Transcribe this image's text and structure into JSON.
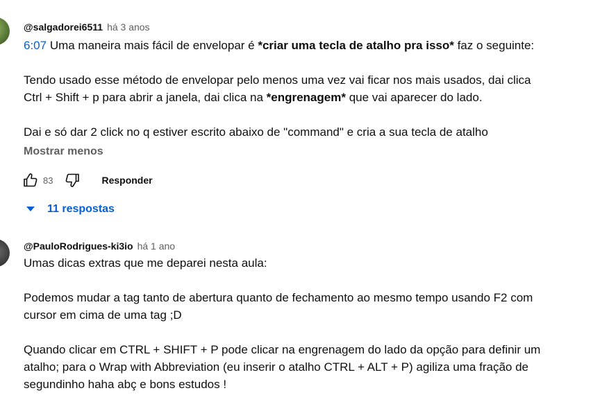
{
  "comments": [
    {
      "author": "@salgadorei6511",
      "time": "há 3 anos",
      "timestamp": "6:07",
      "line1_a": " Uma maneira mais fácil de envelopar é ",
      "line1_bold": "*criar uma tecla de atalho pra isso*",
      "line1_b": " faz o seguinte:",
      "para2_line1": "Tendo usado esse método de envelopar pelo menos uma vez vai ficar nos mais usados, dai clica",
      "para2_line2_a": "Ctrl + Shift + p para abrir a janela, dai clica na ",
      "para2_line2_bold": "*engrenagem*",
      "para2_line2_b": " que vai aparecer do lado.",
      "para3": "Dai e só dar 2 click no q estiver escrito abaixo de \"command\" e cria a sua tecla de atalho",
      "show_less": "Mostrar menos",
      "likes": "83",
      "reply_label": "Responder",
      "replies_label": "11 respostas"
    },
    {
      "author": "@PauloRodrigues-ki3io",
      "time": "há 1 ano",
      "para1": "Umas dicas extras que me deparei nesta aula:",
      "para2_line1": "Podemos mudar a tag tanto de abertura quanto de fechamento ao mesmo tempo usando F2 com",
      "para2_line2": "cursor em cima de uma tag ;D",
      "para3_line1": "Quando clicar em CTRL + SHIFT + P pode clicar na engrenagem do lado da opção para definir um",
      "para3_line2": "atalho; para o Wrap with Abbreviation (eu inserir o atalho CTRL + ALT + P) agiliza uma fração de",
      "para3_line3": "segundinho haha abç e bons estudos !"
    }
  ],
  "icons": {
    "like": "thumb-up-icon",
    "dislike": "thumb-down-icon",
    "expand": "caret-down-icon"
  },
  "colors": {
    "link": "#065fd4",
    "secondary_text": "#606060",
    "text": "#0f0f0f"
  }
}
